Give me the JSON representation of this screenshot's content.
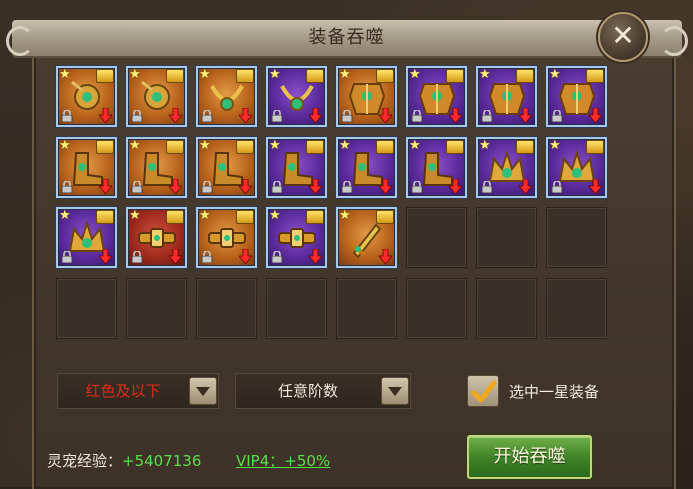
{
  "title": "装备吞噬",
  "colors": {
    "accent_green": "#58e04a",
    "filter_red": "#e02a18",
    "slot_border": "#a9c7e8"
  },
  "close_icon": "close-icon",
  "slots": [
    {
      "bg": "orange",
      "art": "amulet",
      "stars": 1,
      "locked": true,
      "arrow": true
    },
    {
      "bg": "orange",
      "art": "amulet",
      "stars": 1,
      "locked": true,
      "arrow": true
    },
    {
      "bg": "orange",
      "art": "necklace",
      "stars": 1,
      "locked": true,
      "arrow": true
    },
    {
      "bg": "purple",
      "art": "necklace",
      "stars": 1,
      "locked": true,
      "arrow": true
    },
    {
      "bg": "orange",
      "art": "armor",
      "stars": 1,
      "locked": true,
      "arrow": true
    },
    {
      "bg": "purple",
      "art": "armor",
      "stars": 1,
      "locked": true,
      "arrow": true
    },
    {
      "bg": "purple",
      "art": "armor",
      "stars": 1,
      "locked": true,
      "arrow": true
    },
    {
      "bg": "purple",
      "art": "armor",
      "stars": 1,
      "locked": true,
      "arrow": true
    },
    {
      "bg": "orange",
      "art": "boots",
      "stars": 1,
      "locked": true,
      "arrow": true
    },
    {
      "bg": "orange",
      "art": "boots",
      "stars": 1,
      "locked": true,
      "arrow": true
    },
    {
      "bg": "orange",
      "art": "boots",
      "stars": 1,
      "locked": true,
      "arrow": true
    },
    {
      "bg": "purple",
      "art": "boots",
      "stars": 1,
      "locked": true,
      "arrow": true
    },
    {
      "bg": "purple",
      "art": "boots",
      "stars": 1,
      "locked": true,
      "arrow": true
    },
    {
      "bg": "purple",
      "art": "boots",
      "stars": 1,
      "locked": true,
      "arrow": true
    },
    {
      "bg": "purple",
      "art": "crown",
      "stars": 1,
      "locked": true,
      "arrow": true
    },
    {
      "bg": "purple",
      "art": "crown",
      "stars": 1,
      "locked": true,
      "arrow": true
    },
    {
      "bg": "purple",
      "art": "crown",
      "stars": 1,
      "locked": true,
      "arrow": true
    },
    {
      "bg": "red",
      "art": "belt",
      "stars": 1,
      "locked": true,
      "arrow": true
    },
    {
      "bg": "orange",
      "art": "belt",
      "stars": 1,
      "locked": true,
      "arrow": true
    },
    {
      "bg": "purple",
      "art": "belt",
      "stars": 1,
      "locked": true,
      "arrow": true
    },
    {
      "bg": "orange",
      "art": "sword",
      "stars": 1,
      "locked": false,
      "arrow": true
    },
    null,
    null,
    null,
    null,
    null,
    null,
    null,
    null,
    null,
    null,
    null
  ],
  "filters": {
    "quality": {
      "selected": "红色及以下"
    },
    "tier": {
      "selected": "任意阶数"
    }
  },
  "checkbox": {
    "checked": true,
    "label": "选中一星装备"
  },
  "exp": {
    "label": "灵宠经验：",
    "value": "+5407136"
  },
  "vip_bonus": "VIP4：+50%",
  "start_button": "开始吞噬"
}
